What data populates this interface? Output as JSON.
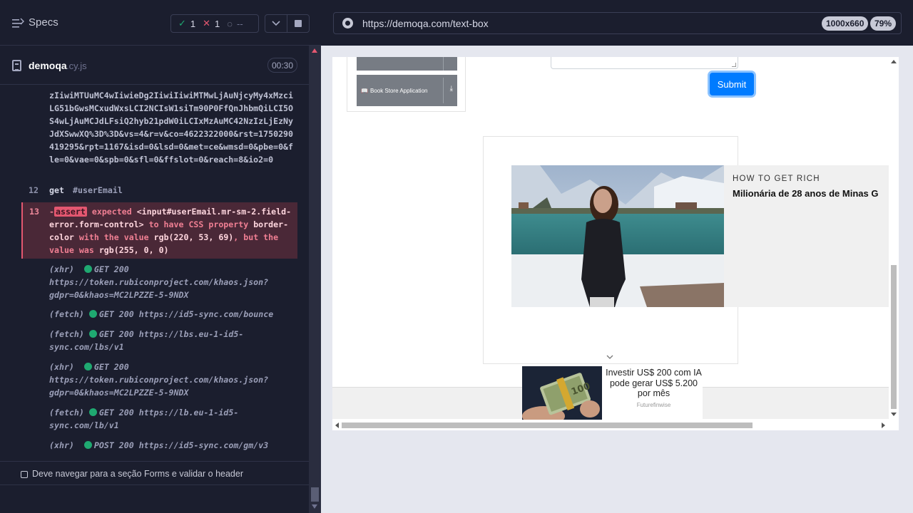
{
  "runner": {
    "specs_label": "Specs",
    "stats": {
      "passed": "1",
      "failed": "1",
      "pending": "--"
    },
    "spec_file": {
      "name": "demoqa",
      "ext": ".cy.js",
      "duration": "00:30"
    }
  },
  "log": {
    "url_continuation": "zIiwiMTUuMC4wIiwieDg2IiwiIiwiMTMwLjAuNjcyMy4xMzciLG51bGwsMCxudWxsLCI2NCIsW1siTm90P0FfQnJhbmQiLCI5OS4wLjAuMCJdLFsiQ2hyb21pdW0iLCIxMzAuMC42NzIzLjEzNyJdXSwwXQ%3D%3D&vs=4&r=v&co=4622322000&rst=1750290419295&rpt=1167&isd=0&lsd=0&met=ce&wmsd=0&pbe=0&fle=0&vae=0&spb=0&sfl=0&ffslot=0&reach=8&io2=0",
    "get_line": {
      "num": "12",
      "cmd": "get",
      "arg": "#userEmail"
    },
    "assert_line": {
      "num": "13",
      "badge": "assert",
      "w1": "expected",
      "w2": "<input#userEmail.mr-sm-2.field-error.form-control>",
      "w3": "to have CSS property",
      "w4": "border-color",
      "w5": "with the value",
      "w6": "rgb(220, 53, 69)",
      "w7": ", but the value was",
      "w8": "rgb(255, 0, 0)"
    },
    "requests": [
      {
        "type": "(xhr)",
        "status": "GET 200",
        "url": "https://token.rubiconproject.com/khaos.json?gdpr=0&khaos=MC2LPZZE-5-9NDX"
      },
      {
        "type": "(fetch)",
        "status": "GET 200",
        "url": "https://id5-sync.com/bounce"
      },
      {
        "type": "(fetch)",
        "status": "GET 200",
        "url": "https://lbs.eu-1-id5-sync.com/lbs/v1"
      },
      {
        "type": "(xhr)",
        "status": "GET 200",
        "url": "https://token.rubiconproject.com/khaos.json?gdpr=0&khaos=MC2LPZZE-5-9NDX"
      },
      {
        "type": "(fetch)",
        "status": "GET 200",
        "url": "https://lb.eu-1-id5-sync.com/lb/v1"
      },
      {
        "type": "(xhr)",
        "status": "POST 200",
        "url": "https://id5-sync.com/gm/v3"
      }
    ],
    "next_test_title": "Deve navegar para a seção Forms e validar o header"
  },
  "browser": {
    "url": "https://demoqa.com/text-box",
    "viewport": "1000x660",
    "zoom": "79%"
  },
  "page": {
    "menu_item": "Book Store Application",
    "submit_label": "Submit",
    "ad1": {
      "kicker": "HOW TO GET RICH",
      "headline": "Milionária de 28 anos de Minas G"
    },
    "ad2": {
      "text": "Investir US$ 200 com IA pode gerar US$ 5.200 por mês",
      "brand": "Futurefinwise"
    }
  },
  "colors": {
    "runner_bg": "#1b1e2e",
    "pass": "#1fa971",
    "fail": "#e45770",
    "submit_blue": "#007bff"
  }
}
